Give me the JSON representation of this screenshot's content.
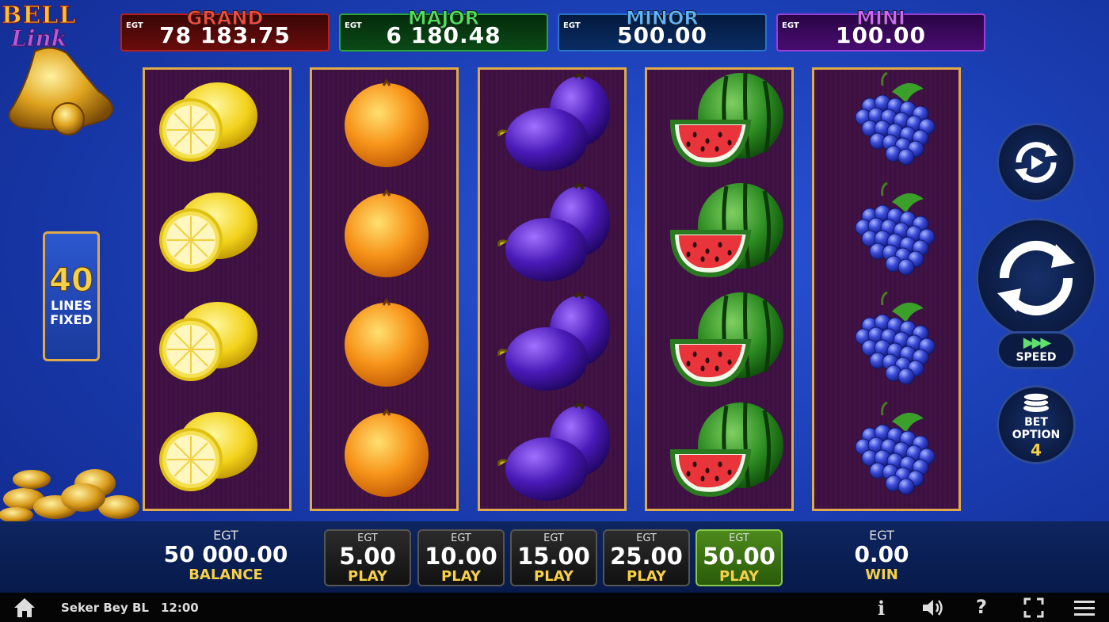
{
  "logo": {
    "line1": "BELL",
    "line2": "Link"
  },
  "jackpots": [
    {
      "label": "GRAND",
      "currency": "EGT",
      "value": "78 183.75"
    },
    {
      "label": "MAJOR",
      "currency": "EGT",
      "value": "6 180.48"
    },
    {
      "label": "MINOR",
      "currency": "EGT",
      "value": "500.00"
    },
    {
      "label": "MINI",
      "currency": "EGT",
      "value": "100.00"
    }
  ],
  "reels": [
    {
      "symbol": "lemon",
      "rows": 4
    },
    {
      "symbol": "orange",
      "rows": 4
    },
    {
      "symbol": "plum",
      "rows": 4
    },
    {
      "symbol": "watermelon",
      "rows": 4
    },
    {
      "symbol": "grapes",
      "rows": 4
    }
  ],
  "lines": {
    "count": "40",
    "line1": "LINES",
    "line2": "FIXED"
  },
  "buttons": {
    "speed_label": "SPEED",
    "bet_option_line1": "BET",
    "bet_option_line2": "OPTION",
    "bet_option_value": "4"
  },
  "balance": {
    "currency": "EGT",
    "value": "50 000.00",
    "label": "BALANCE"
  },
  "win": {
    "currency": "EGT",
    "value": "0.00",
    "label": "WIN"
  },
  "bets": [
    {
      "currency": "EGT",
      "value": "5.00",
      "label": "PLAY",
      "active": false
    },
    {
      "currency": "EGT",
      "value": "10.00",
      "label": "PLAY",
      "active": false
    },
    {
      "currency": "EGT",
      "value": "15.00",
      "label": "PLAY",
      "active": false
    },
    {
      "currency": "EGT",
      "value": "25.00",
      "label": "PLAY",
      "active": false
    },
    {
      "currency": "EGT",
      "value": "50.00",
      "label": "PLAY",
      "active": true
    }
  ],
  "statusbar": {
    "game_name": "Seker Bey BL",
    "time": "12:00"
  },
  "colors": {
    "accent_gold": "#f6d048",
    "reel_border": "#e0a94a",
    "active_bet": "#4d8a1c"
  }
}
